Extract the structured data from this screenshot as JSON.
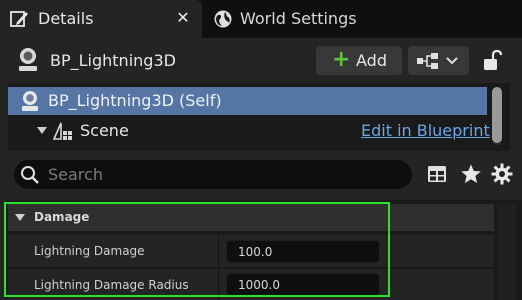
{
  "tabs": [
    {
      "label": "Details",
      "icon": "details-pencil-icon",
      "active": true
    },
    {
      "label": "World Settings",
      "icon": "globe-icon",
      "active": false
    }
  ],
  "tab_close_glyph": "✕",
  "actor": {
    "name": "BP_Lightning3D",
    "icon": "actor-pawn-icon"
  },
  "toolbar": {
    "add_label": "Add",
    "add_plus": "+",
    "blueprint_icon": "blueprint-hierarchy-icon",
    "lock_icon": "lock-icon"
  },
  "components": {
    "self_label": "BP_Lightning3D (Self)",
    "scene_label": "Scene",
    "edit_link": "Edit in Blueprint"
  },
  "search": {
    "placeholder": "Search",
    "value": ""
  },
  "category": {
    "label": "Damage",
    "expanded": true
  },
  "properties": [
    {
      "name": "Lightning Damage",
      "value": "100.0"
    },
    {
      "name": "Lightning Damage Radius",
      "value": "1000.0"
    }
  ],
  "colors": {
    "accent_green": "#5fc23a",
    "selection_blue": "#5576a4",
    "link_blue": "#6aa6e8",
    "highlight_green": "#2ee02e"
  }
}
